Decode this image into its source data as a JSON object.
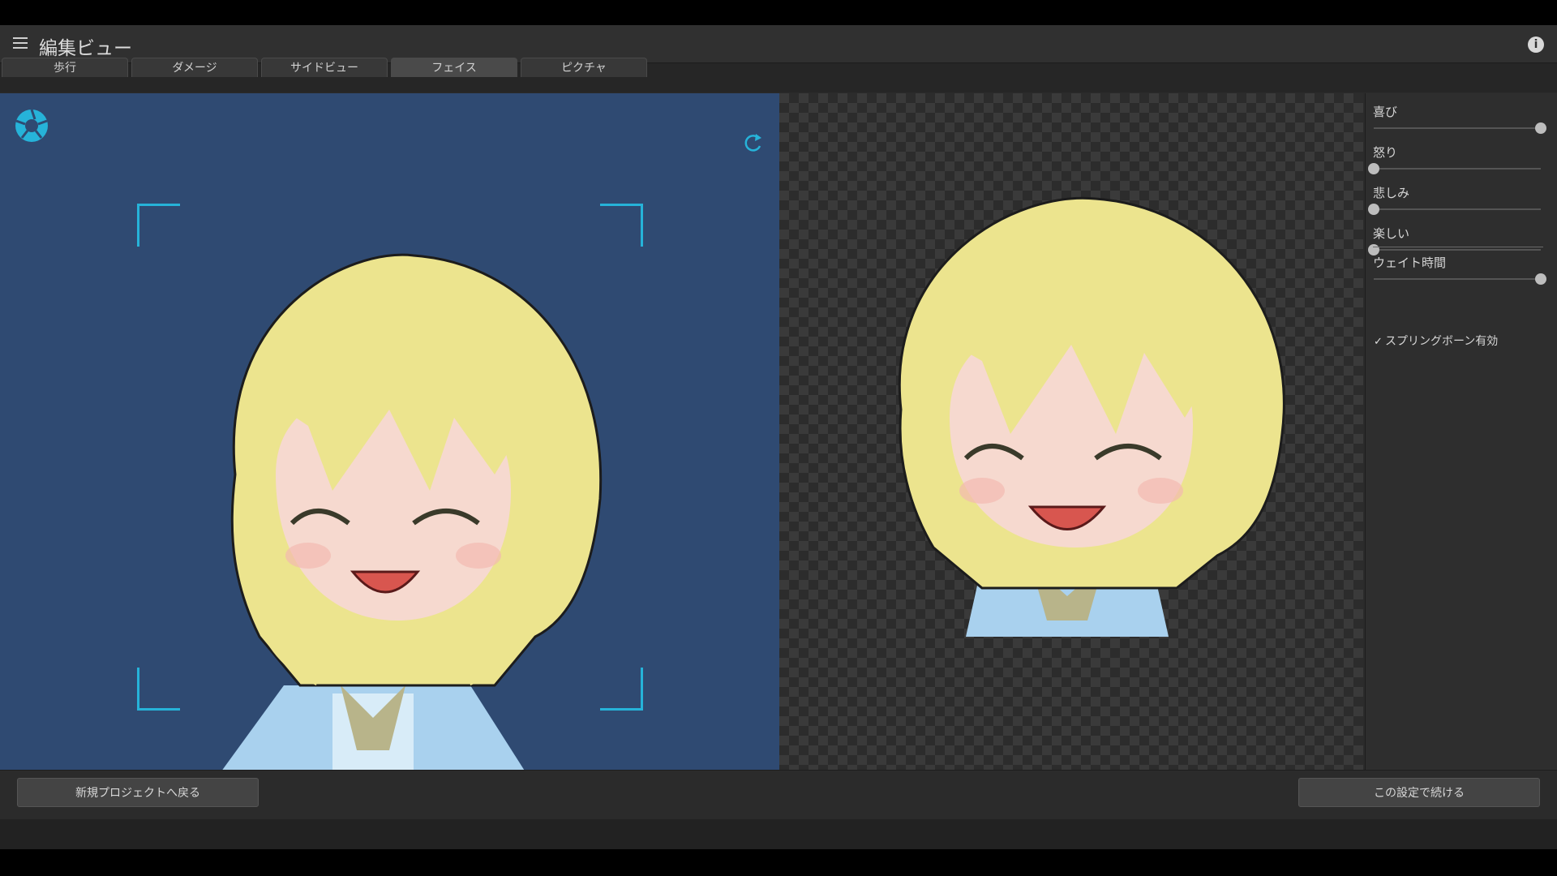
{
  "window": {
    "title": "編集ビュー"
  },
  "icons": {
    "menu": "hamburger-icon",
    "info": "info-icon",
    "camera": "aperture-icon",
    "refresh": "refresh-icon"
  },
  "tabs": [
    {
      "label": "歩行"
    },
    {
      "label": "ダメージ"
    },
    {
      "label": "サイドビュー"
    },
    {
      "label": "フェイス",
      "active": true
    },
    {
      "label": "ピクチャ"
    }
  ],
  "sliders": [
    {
      "label": "喜び",
      "value": 1.0
    },
    {
      "label": "怒り",
      "value": 0.0
    },
    {
      "label": "悲しみ",
      "value": 0.0
    },
    {
      "label": "楽しい",
      "value": 0.0
    }
  ],
  "wait_slider": {
    "label": "ウェイト時間",
    "value": 1.0
  },
  "spring_bone": {
    "label": "スプリングボーン有効",
    "checked": true
  },
  "buttons": {
    "back": "新規プロジェクトへ戻る",
    "continue": "この設定で続ける"
  },
  "colors": {
    "accent": "#26b3d9",
    "viewport_bg": "#2f4a72",
    "hair": "#ece48e"
  }
}
